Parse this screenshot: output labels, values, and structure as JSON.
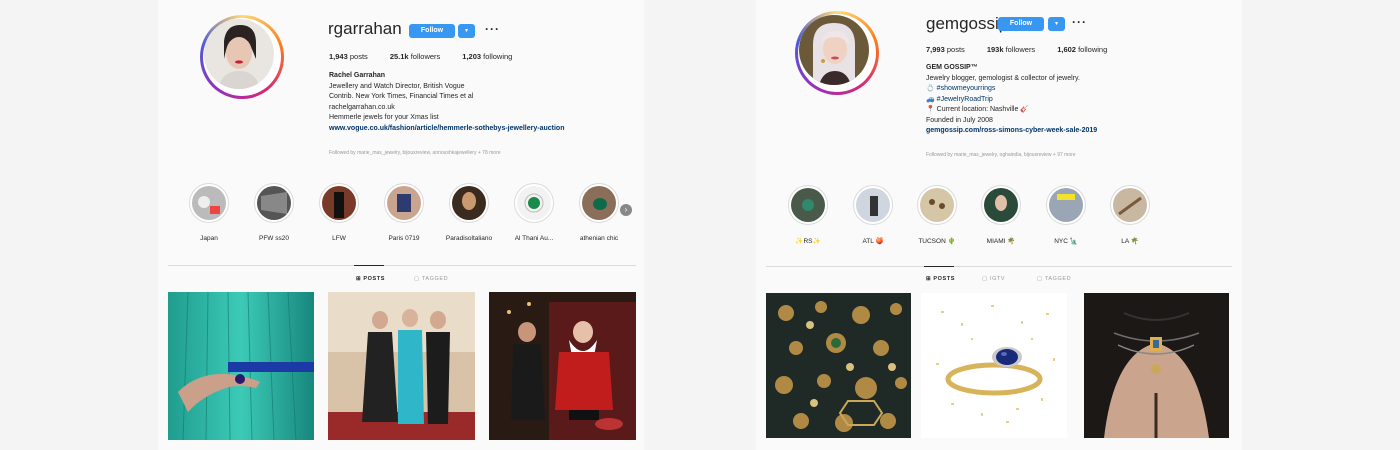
{
  "profiles": [
    {
      "username": "rgarrahan",
      "follow_label": "Follow",
      "dropdown_symbol": "▾",
      "more_symbol": "···",
      "verified_symbol": "✓",
      "stats": {
        "posts": "1,943",
        "posts_label": "posts",
        "followers": "25.1k",
        "followers_label": "followers",
        "following": "1,203",
        "following_label": "following"
      },
      "bio": {
        "name": "Rachel Garrahan",
        "lines": [
          "Jewellery and Watch Director, British Vogue",
          "Contrib. New York Times, Financial Times et al",
          "rachelgarrahan.co.uk",
          "Hemmerle jewels for your Xmas list"
        ],
        "link": "www.vogue.co.uk/fashion/article/hemmerle-sothebys-jewellery-auction"
      },
      "followed_by": "Followed by marie_mas_jewelry, bijouxreview, annoushkajewellery + 78 more",
      "highlights": [
        {
          "label": "Japan"
        },
        {
          "label": "PFW ss20"
        },
        {
          "label": "LFW"
        },
        {
          "label": "Paris 0719"
        },
        {
          "label": "Paradisoltaliano"
        },
        {
          "label": "Al Thani Au..."
        },
        {
          "label": "athenian chic"
        }
      ],
      "next_symbol": "›",
      "tabs": [
        {
          "icon": "⊞",
          "label": "POSTS",
          "active": true
        },
        {
          "icon": "▢",
          "label": "TAGGED",
          "active": false
        }
      ]
    },
    {
      "username": "gemgossip",
      "follow_label": "Follow",
      "dropdown_symbol": "▾",
      "more_symbol": "···",
      "stats": {
        "posts": "7,993",
        "posts_label": "posts",
        "followers": "193k",
        "followers_label": "followers",
        "following": "1,602",
        "following_label": "following"
      },
      "bio": {
        "name": "GEM GOSSIP™",
        "line1": "Jewelry blogger, gemologist & collector of jewelry.",
        "tag1": "#showmeyourrings",
        "tag2": "#JewelryRoadTrip",
        "location": "Current location: Nashville 🎸",
        "founded": "Founded in July 2008",
        "link": "gemgossip.com/ross-simons-cyber-week-sale-2019"
      },
      "followed_by": "Followed by marie_mas_jewelry, oghaindia, bijouxreview + 97 more",
      "highlights": [
        {
          "label": "✨RS✨"
        },
        {
          "label": "ATL 🍑"
        },
        {
          "label": "TUCSON 🌵"
        },
        {
          "label": "MIAMI 🌴"
        },
        {
          "label": "NYC 🗽"
        },
        {
          "label": "LA 🌴"
        }
      ],
      "tabs": [
        {
          "icon": "⊞",
          "label": "POSTS",
          "active": true
        },
        {
          "icon": "▢",
          "label": "IGTV",
          "active": false
        },
        {
          "icon": "▢",
          "label": "TAGGED",
          "active": false
        }
      ]
    }
  ],
  "colors": {
    "follow_blue": "#3897f0",
    "link_blue": "#003569",
    "background": "#fafafa"
  }
}
